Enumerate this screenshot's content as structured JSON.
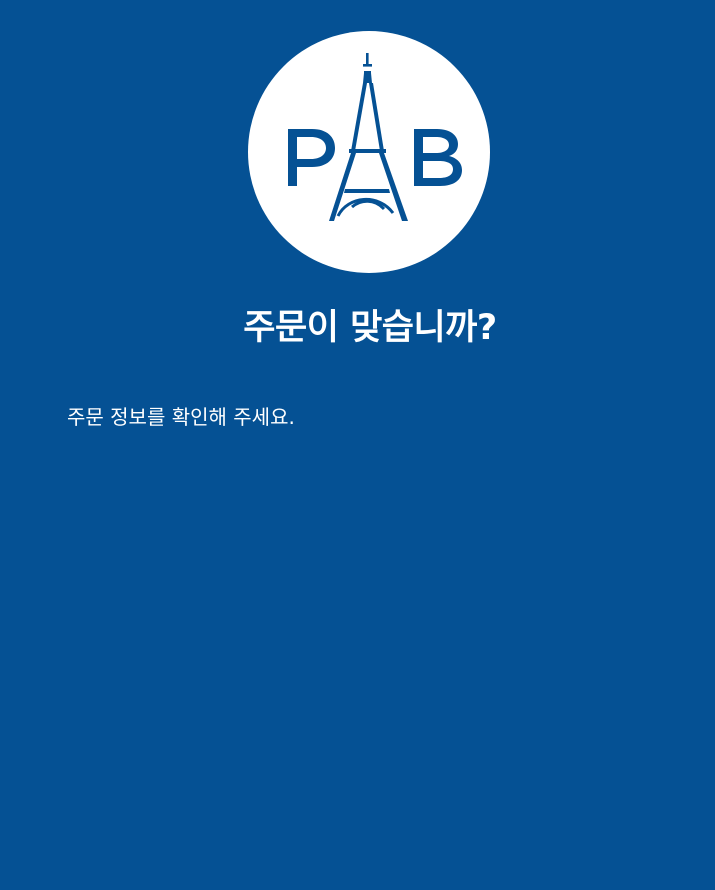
{
  "brand": {
    "logo_text": "PAB",
    "logo_color": "#055194",
    "background_color": "#055194",
    "circle_color": "#ffffff"
  },
  "dialog": {
    "title": "주문이 맞습니까?",
    "message": "주문 정보를 확인해 주세요."
  },
  "icons": {
    "logo": "eiffel-tower-logo-icon"
  }
}
